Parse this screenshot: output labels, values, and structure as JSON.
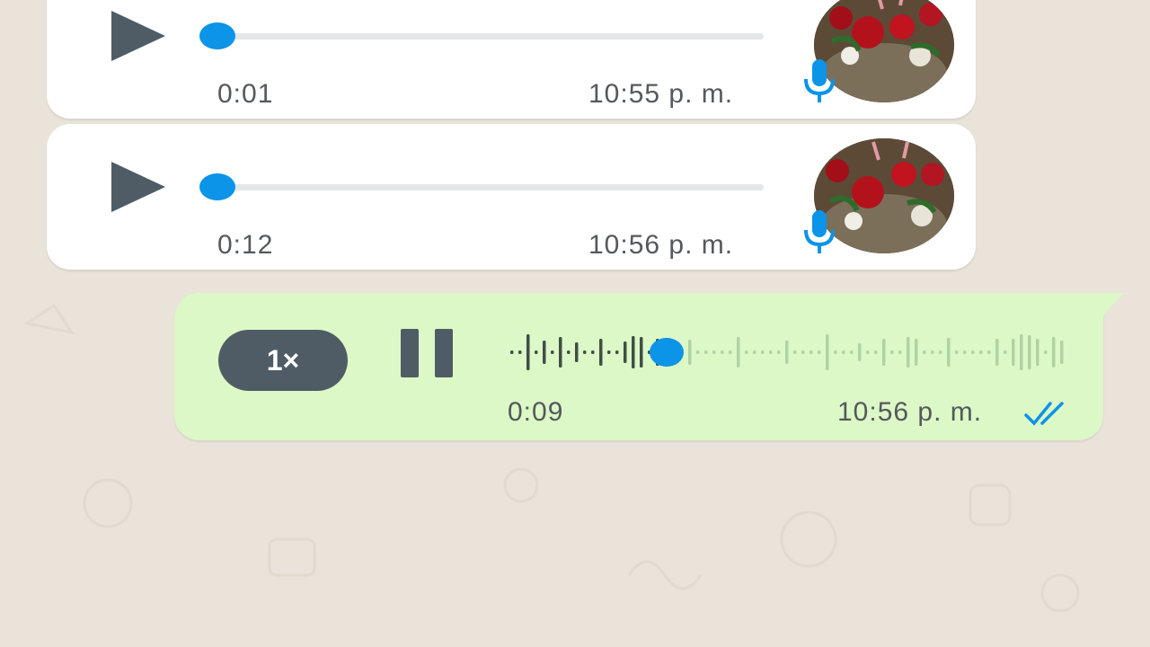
{
  "messages": [
    {
      "direction": "incoming",
      "duration": "0:01",
      "time": "10:55 p. m.",
      "progress": 0
    },
    {
      "direction": "incoming",
      "duration": "0:12",
      "time": "10:56 p. m.",
      "progress": 0
    },
    {
      "direction": "outgoing",
      "speed": "1×",
      "duration": "0:09",
      "time": "10:56 p. m.",
      "state": "playing",
      "status": "read"
    }
  ],
  "icons": {
    "play": "play-icon",
    "pause": "pause-icon",
    "mic": "microphone-icon",
    "read_receipt": "double-check-icon"
  },
  "colors": {
    "background": "#e9e3da",
    "incoming_bubble": "#ffffff",
    "outgoing_bubble": "#dcf8c6",
    "accent_blue": "#0b94e8",
    "controls": "#4f5c66",
    "waveform_played": "#3f4f47",
    "waveform_unplayed": "#afd3a4"
  }
}
